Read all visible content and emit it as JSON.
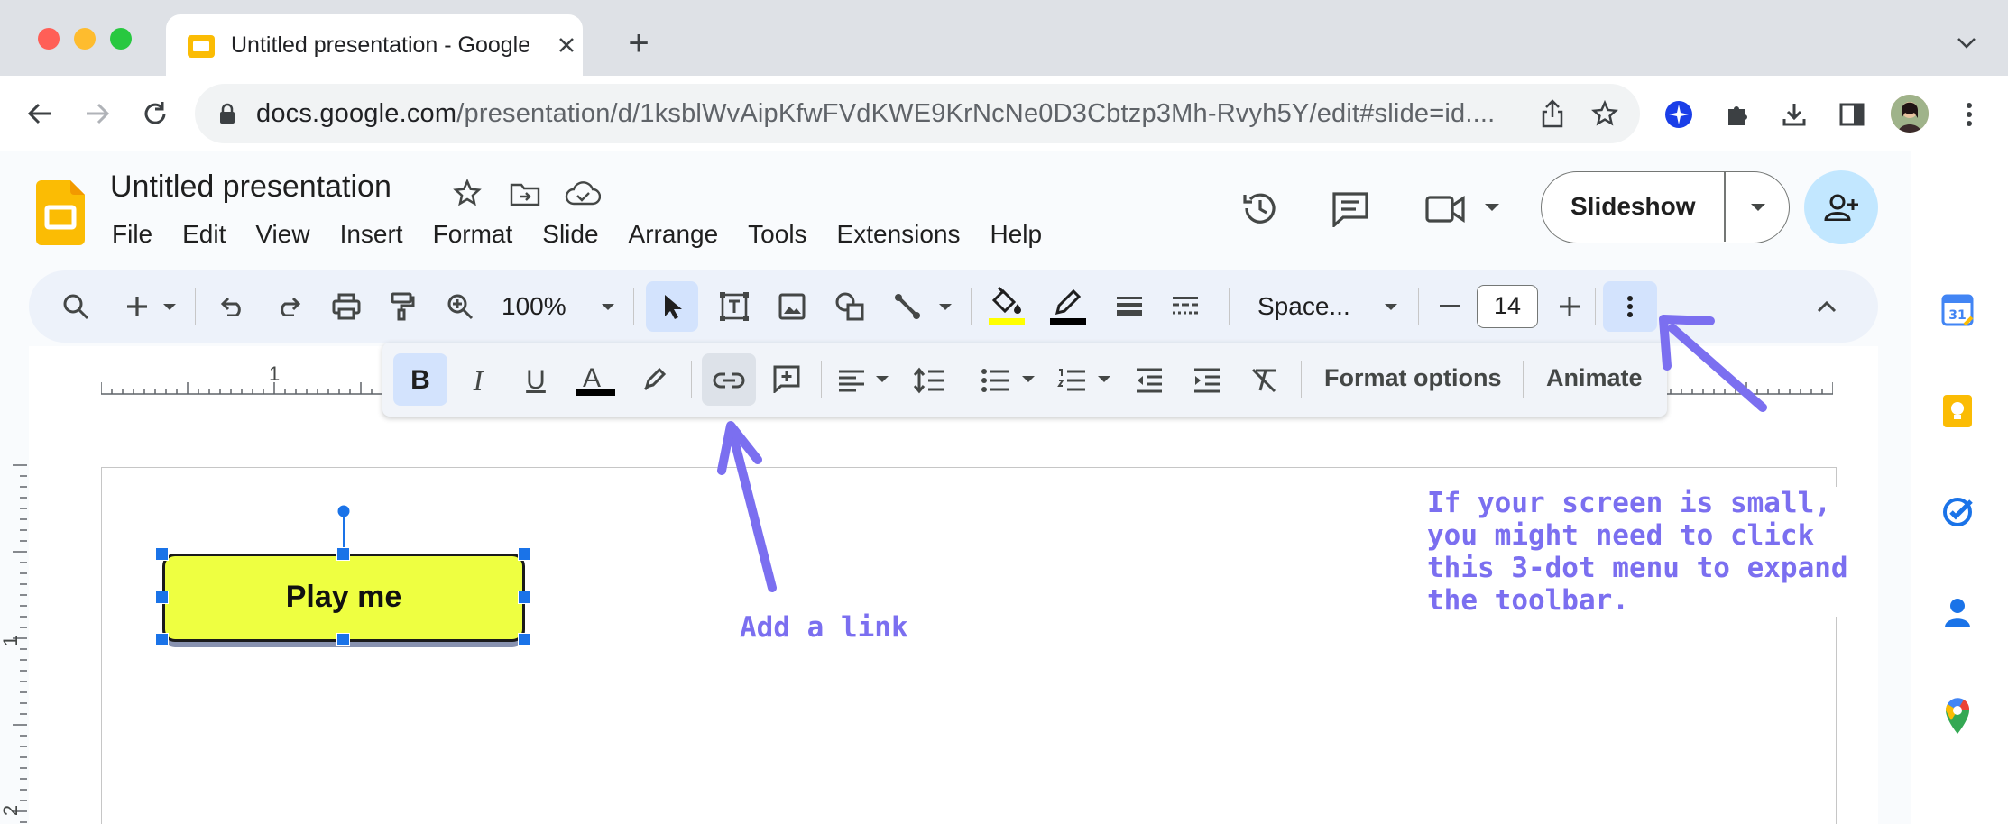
{
  "browser": {
    "tab_title": "Untitled presentation - Google Slides",
    "new_tab_symbol": "+",
    "url_domain": "docs.google.com",
    "url_path": "/presentation/d/1ksblWvAipKfwFVdKWE9KrNcNe0D3Cbtzp3Mh-Rvyh5Y/edit#slide=id...."
  },
  "doc": {
    "title": "Untitled presentation",
    "menu": [
      "File",
      "Edit",
      "View",
      "Insert",
      "Format",
      "Slide",
      "Arrange",
      "Tools",
      "Extensions",
      "Help"
    ]
  },
  "header": {
    "slideshow_label": "Slideshow"
  },
  "toolbar": {
    "zoom": "100%",
    "font": "Space...",
    "font_size": "14"
  },
  "format_toolbar": {
    "format_options": "Format options",
    "animate": "Animate",
    "underline_letter": "U",
    "text_color_letter": "A",
    "bold_letter": "B",
    "italic_letter": "I"
  },
  "slide": {
    "button_label": "Play me"
  },
  "rulers": {
    "h_mark": "1",
    "v_mark_1": "1",
    "v_mark_2": "2"
  },
  "annotations": {
    "link_note": "Add a link",
    "small_screen_note": "If your screen is small,\nyou might need to click\nthis 3-dot menu to expand\nthe toolbar."
  },
  "colors": {
    "accent": "#1a73e8",
    "annotation": "#7b6ff0",
    "button_fill": "#eeff41",
    "share_bg": "#c2e7ff"
  }
}
